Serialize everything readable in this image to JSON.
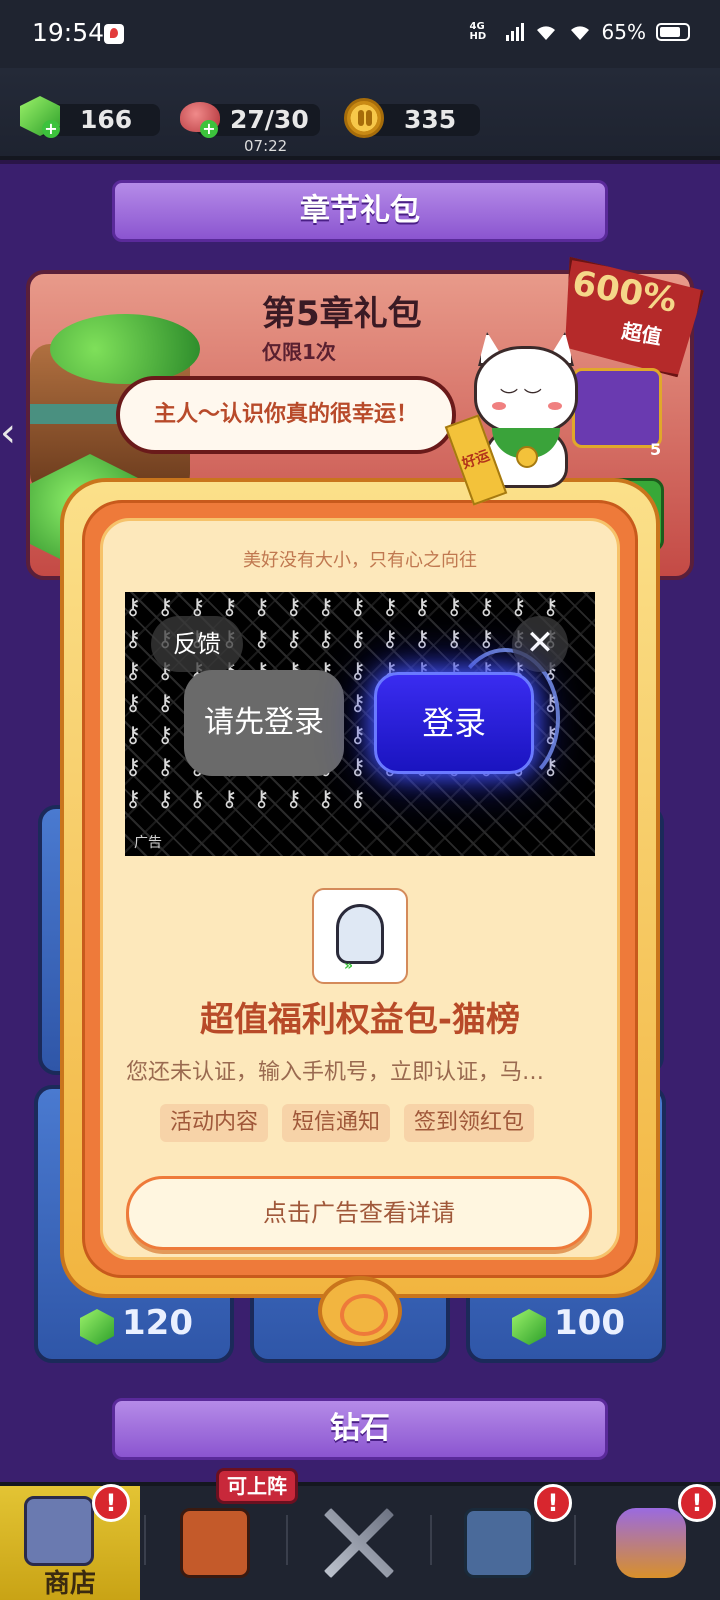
{
  "status_bar": {
    "time": "19:54",
    "network": "4G HD",
    "battery": "65%"
  },
  "resources": {
    "gems": "166",
    "stamina": "27/30",
    "stamina_timer": "07:22",
    "coins": "335"
  },
  "section_chapter": {
    "title": "章节礼包"
  },
  "chapter_pack": {
    "title": "第5章礼包",
    "limit": "仅限1次",
    "badge_value": "600%",
    "badge_label": "超值",
    "slot_count": "5"
  },
  "mascot": {
    "speech": "主人～认识你真的很幸运！",
    "sash": "好运"
  },
  "dialog": {
    "slogan": "美好没有大小，只有心之向往",
    "ad": {
      "feedback": "反馈",
      "close": "✕",
      "login_first": "请先登录",
      "login": "登录",
      "tag": "广告"
    },
    "promo_title": "超值福利权益包-猫榜",
    "promo_desc": "您还未认证，输入手机号，立即认证，马…",
    "chips": [
      "活动内容",
      "短信通知",
      "签到领红包"
    ],
    "cta": "点击广告查看详请"
  },
  "lower_cards": {
    "prices": [
      "120",
      "100"
    ]
  },
  "section_gems": {
    "title": "钻石"
  },
  "bottom_nav": {
    "shop_label": "商店",
    "on_deck": "可上阵",
    "alert": "!"
  },
  "colors": {
    "accent_orange": "#ee7a3a",
    "panel_cream": "#fde8bb",
    "promo_red": "#b84a28",
    "bg_purple": "#3a1f6e"
  }
}
